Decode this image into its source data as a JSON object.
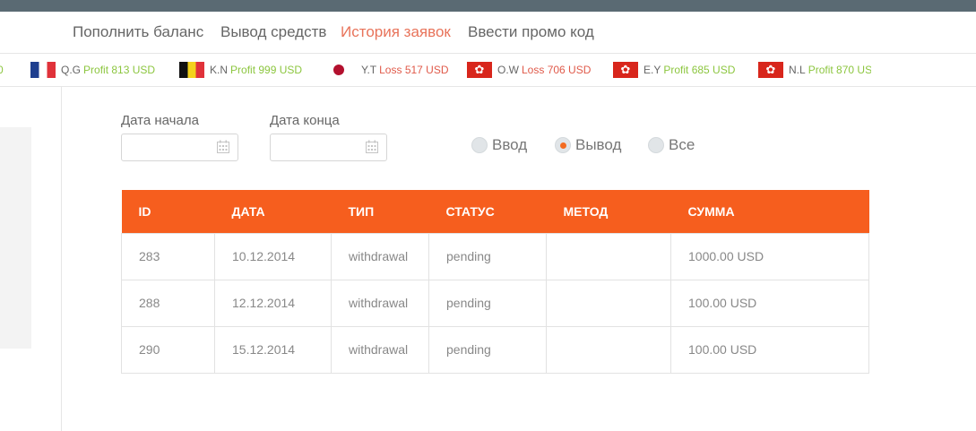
{
  "nav": {
    "items": [
      {
        "label": "Пополнить баланс"
      },
      {
        "label": "Вывод средств"
      },
      {
        "label": "История заявок",
        "active": true
      },
      {
        "label": "Ввести промо код"
      }
    ]
  },
  "ticker": [
    {
      "name": "",
      "kind": "Profit",
      "value": "0",
      "flag": "none"
    },
    {
      "name": "Q.G",
      "kind": "Profit",
      "value": "813 USD",
      "flag": "flag-france"
    },
    {
      "name": "K.N",
      "kind": "Profit",
      "value": "999 USD",
      "flag": "flag-belgium"
    },
    {
      "name": "Y.T",
      "kind": "Loss",
      "value": "517 USD",
      "flag": "flag-japan"
    },
    {
      "name": "O.W",
      "kind": "Loss",
      "value": "706 USD",
      "flag": "flag-hong-kong"
    },
    {
      "name": "E.Y",
      "kind": "Profit",
      "value": "685 USD",
      "flag": "flag-hong-kong"
    },
    {
      "name": "N.L",
      "kind": "Profit",
      "value": "870 US",
      "flag": "flag-hong-kong"
    }
  ],
  "filters": {
    "start_label": "Дата начала",
    "end_label": "Дата конца",
    "start_value": "",
    "end_value": "",
    "radios": [
      {
        "label": "Ввод",
        "checked": false
      },
      {
        "label": "Вывод",
        "checked": true
      },
      {
        "label": "Все",
        "checked": false
      }
    ]
  },
  "table": {
    "headers": [
      "ID",
      "ДАТА",
      "ТИП",
      "СТАТУС",
      "МЕТОД",
      "СУММА"
    ],
    "rows": [
      {
        "id": "283",
        "date": "10.12.2014",
        "type": "withdrawal",
        "status": "pending",
        "method": "",
        "sum": "1000.00 USD"
      },
      {
        "id": "288",
        "date": "12.12.2014",
        "type": "withdrawal",
        "status": "pending",
        "method": "",
        "sum": "100.00 USD"
      },
      {
        "id": "290",
        "date": "15.12.2014",
        "type": "withdrawal",
        "status": "pending",
        "method": "",
        "sum": "100.00 USD"
      }
    ]
  },
  "colors": {
    "accent": "#f65e1e",
    "active_nav": "#e8735a",
    "profit": "#8cc63f",
    "loss": "#e05a4a",
    "topbar": "#5a6a73"
  }
}
